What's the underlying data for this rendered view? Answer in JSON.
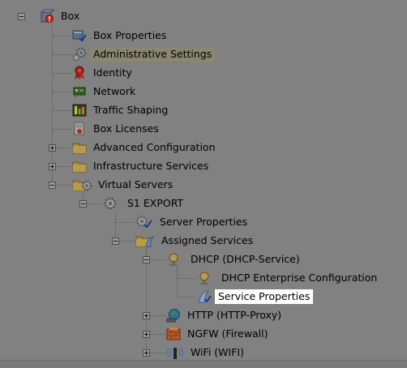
{
  "tree": {
    "root": {
      "label": "Box",
      "icon": "box-icon"
    },
    "box_children": [
      {
        "label": "Box Properties",
        "icon": "box-properties-icon"
      },
      {
        "label": "Administrative Settings",
        "icon": "gears-icon"
      },
      {
        "label": "Identity",
        "icon": "ribbon-icon"
      },
      {
        "label": "Network",
        "icon": "network-card-icon"
      },
      {
        "label": "Traffic Shaping",
        "icon": "traffic-shaping-icon"
      },
      {
        "label": "Box Licenses",
        "icon": "license-icon"
      },
      {
        "label": "Advanced Configuration",
        "icon": "folder-icon"
      },
      {
        "label": "Infrastructure Services",
        "icon": "folder-icon"
      },
      {
        "label": "Virtual Servers",
        "icon": "folder-gear-icon"
      }
    ],
    "server": {
      "label": "S1 EXPORT",
      "icon": "gear-icon"
    },
    "server_children": [
      {
        "label": "Server Properties",
        "icon": "server-properties-icon"
      },
      {
        "label": "Assigned Services",
        "icon": "folder-service-icon"
      }
    ],
    "services": [
      {
        "label": "DHCP (DHCP-Service)",
        "icon": "dhcp-icon"
      },
      {
        "label": "HTTP (HTTP-Proxy)",
        "icon": "globe-icon"
      },
      {
        "label": "NGFW (Firewall)",
        "icon": "firewall-icon"
      },
      {
        "label": "WiFi (WIFI)",
        "icon": "wifi-icon"
      }
    ],
    "dhcp_children": [
      {
        "label": "DHCP Enterprise Configuration",
        "icon": "dhcp-icon"
      },
      {
        "label": "Service Properties",
        "icon": "service-properties-icon"
      }
    ]
  },
  "colors": {
    "background": "#808080",
    "hover_highlight": "#8a8770",
    "selected_highlight": "#ffffff"
  }
}
